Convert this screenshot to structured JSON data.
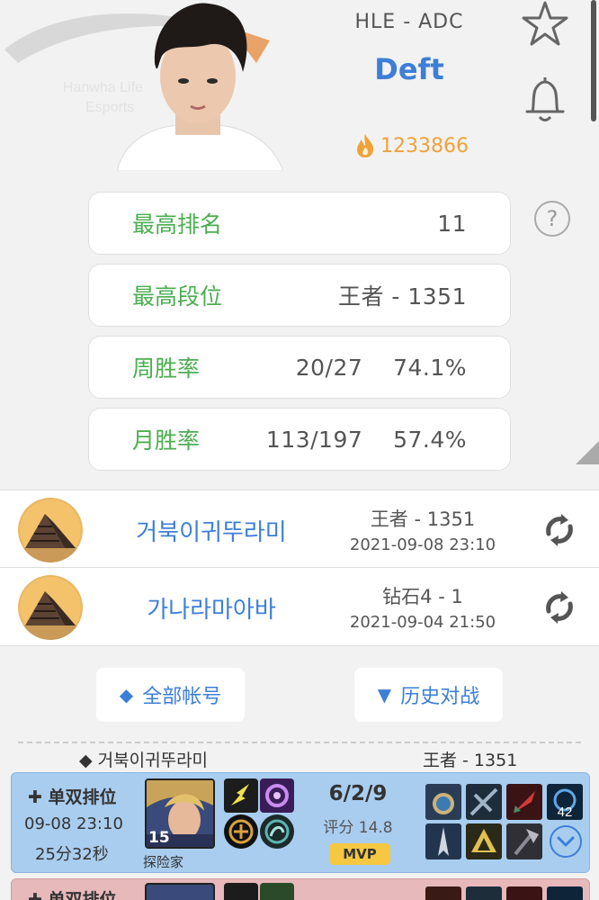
{
  "header": {
    "team_role": "HLE - ADC",
    "player_name": "Deft",
    "heat_value": "1233866"
  },
  "stats": [
    {
      "label": "最高排名",
      "value": "11"
    },
    {
      "label": "最高段位",
      "value": "王者 - 1351"
    },
    {
      "label": "周胜率",
      "value": "20/27    74.1%"
    },
    {
      "label": "月胜率",
      "value": "113/197    57.4%"
    }
  ],
  "help_glyph": "?",
  "accounts": [
    {
      "name": "거북이귀뚜라미",
      "rank": "王者 - 1351",
      "time": "2021-09-08 23:10"
    },
    {
      "name": "가나라마아바",
      "rank": "钻石4 - 1",
      "time": "2021-09-04 21:50"
    }
  ],
  "buttons": {
    "all_accounts": {
      "glyph": "◆",
      "label": "全部帐号"
    },
    "history": {
      "glyph": "▼",
      "label": "历史对战"
    }
  },
  "section": {
    "glyph": "◆",
    "account_name": "거북이귀뚜라미",
    "rank": "王者 - 1351"
  },
  "matches": [
    {
      "mode": "✚ 单双排位",
      "date": "09-08 23:10",
      "duration": "25分32秒",
      "champion_level": "15",
      "champion_name": "探险家",
      "kda": "6/2/9",
      "score": "评分 14.8",
      "badge": "MVP",
      "item_overlay": "42",
      "result_color": "#a9cdef"
    },
    {
      "mode": "✚ 单双排位",
      "result_color": "#e7b9bb"
    }
  ],
  "colors": {
    "accent_blue": "#3d7fd8",
    "stat_green": "#4bae4f",
    "heat_orange": "#f0a23a",
    "mvp_yellow": "#f6c740"
  },
  "icons": [
    "star-icon",
    "bell-icon",
    "flame-icon",
    "help-icon",
    "refresh-icon",
    "chevron-down-icon"
  ]
}
